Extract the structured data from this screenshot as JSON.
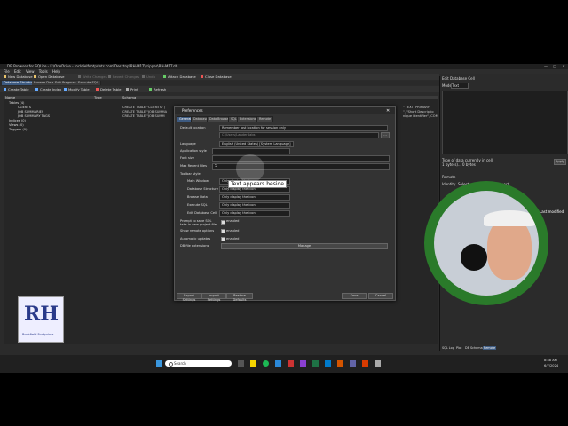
{
  "app": {
    "title": "DB Browser for SQLite - F:\\OneDrive - rockfielfootprints.com\\Desktop\\RH-M1T\\tripper\\RH-M1T.db"
  },
  "window_controls": [
    "—",
    "□",
    "✕"
  ],
  "menu": [
    "File",
    "Edit",
    "View",
    "Tools",
    "Help"
  ],
  "toolbar": [
    "New Database",
    "Open Database",
    "Write Changes",
    "Revert Changes",
    "Undo",
    "Attach Database",
    "Close Database"
  ],
  "main_tabs": [
    "Database Structure",
    "Browse Data",
    "Edit Pragmas",
    "Execute SQL"
  ],
  "structure_toolbar": [
    "Create Table",
    "Create Index",
    "Modify Table",
    "Delete Table",
    "Print",
    "Refresh"
  ],
  "tree": {
    "headers": [
      "Name",
      "Type",
      "Schema"
    ],
    "rows": [
      {
        "name": "Tables (4)",
        "schema": ""
      },
      {
        "name": "CLIENTS",
        "schema": "CREATE TABLE \"CLIENTS\" ("
      },
      {
        "name": "JOB SUMMARIES",
        "schema": "CREATE TABLE \"JOB SUMMA"
      },
      {
        "name": "JOB SUMMARY TAGS",
        "schema": "CREATE TABLE \"JOB SUMM"
      },
      {
        "name": "Indices (0)",
        "schema": ""
      },
      {
        "name": "Views (0)",
        "schema": ""
      },
      {
        "name": "Triggers (0)",
        "schema": ""
      }
    ],
    "right_text": [
      "\" TEXT, PRIMARY",
      "\", \"Short Descriptio",
      "nique identifier\", COM"
    ]
  },
  "right_panel": {
    "title": "Edit Database Cell",
    "mode_label": "Mode:",
    "mode_value": "Text",
    "status": "Type of data currently in cell",
    "size": "1 byte(s)... 0 bytes",
    "apply": "Apply"
  },
  "remote": {
    "title": "Remote",
    "identity_label": "Identity",
    "identity_value": "Select an identity to connect",
    "modified": "Last modified",
    "bottom_tabs": [
      "SQL Log",
      "Plot",
      "DB Schema",
      "Remote"
    ]
  },
  "prefs": {
    "title": "Preferences",
    "tabs": [
      "General",
      "Database",
      "Data Browser",
      "SQL",
      "Extensions",
      "Remote"
    ],
    "default_location_label": "Default location",
    "default_location_value": "Remember last location for session only",
    "path_value": "C:/Users/LanderBabs",
    "language_label": "Language",
    "language_value": "English (United States) [System Language]",
    "app_style_label": "Application style",
    "font_size_label": "Font size",
    "max_recent_label": "Max Recent Files",
    "max_recent_value": "5",
    "toolbar_style_label": "Toolbar style",
    "toolbar_rows": [
      {
        "label": "Main Window",
        "value": "Only display the icon"
      },
      {
        "label": "Database Structure",
        "value": "Only display the icon"
      },
      {
        "label": "Browse Data",
        "value": "Only display the icon"
      },
      {
        "label": "Execute SQL",
        "value": "Only display the icon"
      },
      {
        "label": "Edit Database Cell",
        "value": "Only display the icon"
      }
    ],
    "tooltip": "Text appears beside",
    "checkboxes": [
      {
        "label": "Prompt to save SQL tabs in new project file",
        "value": "enabled"
      },
      {
        "label": "Show remote options",
        "value": "enabled"
      },
      {
        "label": "Automatic updates",
        "value": "enabled"
      }
    ],
    "db_file_ext_label": "DB file extensions",
    "manage_button": "Manage",
    "footer_buttons": [
      "Export Settings",
      "Import Settings",
      "Restore Defaults"
    ],
    "save": "Save",
    "cancel": "Cancel"
  },
  "taskbar": {
    "search_placeholder": "Search",
    "time": "8:48 AM",
    "date": "6/7/2024"
  },
  "logo": {
    "initials": "RH",
    "caption": "Rockfield Footprints"
  }
}
